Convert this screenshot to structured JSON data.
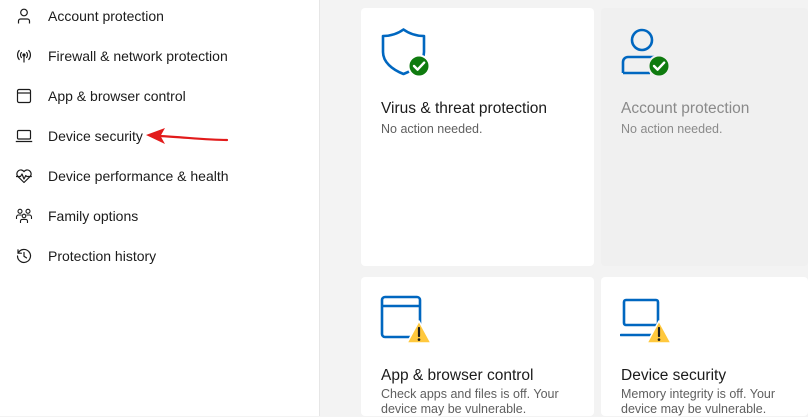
{
  "sidebar": {
    "items": [
      {
        "label": "Account protection",
        "icon": "person-icon"
      },
      {
        "label": "Firewall & network protection",
        "icon": "wifi-antenna-icon"
      },
      {
        "label": "App & browser control",
        "icon": "browser-window-icon"
      },
      {
        "label": "Device security",
        "icon": "laptop-icon"
      },
      {
        "label": "Device performance & health",
        "icon": "heart-pulse-icon"
      },
      {
        "label": "Family options",
        "icon": "family-icon"
      },
      {
        "label": "Protection history",
        "icon": "history-clock-icon"
      }
    ]
  },
  "cards": [
    {
      "title": "Virus & threat protection",
      "description": "No action needed.",
      "icon": "shield-check-icon",
      "status": "ok"
    },
    {
      "title": "Account protection",
      "description": "No action needed.",
      "icon": "person-check-icon",
      "status": "ok"
    },
    {
      "title": "App & browser control",
      "description": "Check apps and files is off. Your device may be vulnerable.",
      "icon": "browser-warning-icon",
      "status": "warning"
    },
    {
      "title": "Device security",
      "description": "Memory integrity is off. Your device may be vulnerable.",
      "icon": "laptop-warning-icon",
      "status": "warning"
    }
  ],
  "colors": {
    "accent_blue": "#0067c0",
    "ok_green": "#0f7b0f",
    "warning_yellow": "#ffc83d",
    "annotation_red": "#e21b1b"
  }
}
